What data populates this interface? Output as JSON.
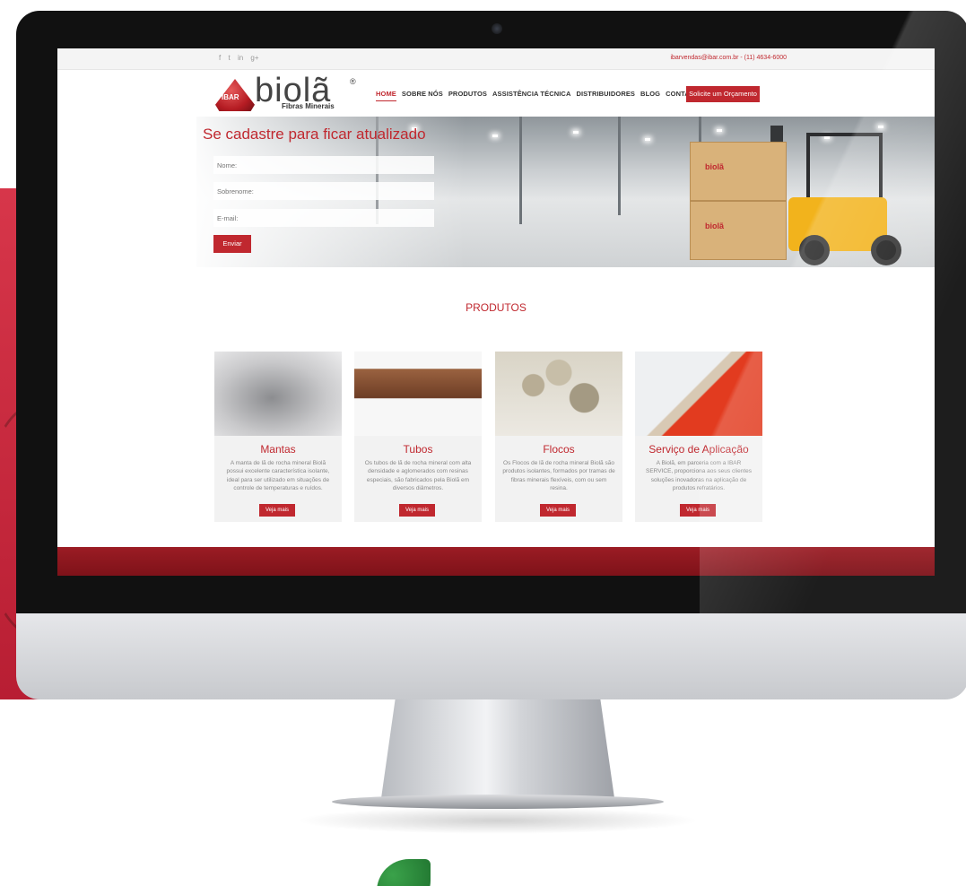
{
  "topbar": {
    "social_icons": [
      "facebook-icon",
      "twitter-icon",
      "linkedin-icon",
      "google-plus-icon"
    ],
    "social_glyphs": [
      "f",
      "t",
      "in",
      "g+"
    ],
    "contact": "ibarvendas@ibar.com.br - (11) 4634-6000"
  },
  "logo": {
    "badge_text": "IBAR",
    "wordmark": "biolã",
    "reg": "®",
    "subtitle": "Fibras Minerais"
  },
  "nav": {
    "items": [
      "HOME",
      "SOBRE NÓS",
      "PRODUTOS",
      "ASSISTÊNCIA TÉCNICA",
      "DISTRIBUIDORES",
      "BLOG",
      "CONTATO"
    ],
    "active": "HOME",
    "quote_button": "Solicite um Orçamento"
  },
  "signup": {
    "title": "Se cadastre para ficar atualizado",
    "name_placeholder": "Nome:",
    "surname_placeholder": "Sobrenome:",
    "email_placeholder": "E-mail:",
    "submit": "Enviar"
  },
  "hero": {
    "box_brand": "biolã"
  },
  "products": {
    "title": "PRODUTOS",
    "cards": [
      {
        "title": "Mantas",
        "description": "A manta de lã de rocha mineral Biolã possui excelente característica isolante, ideal para ser utilizado em situações de controle de temperaturas e ruídos.",
        "button": "Veja mais"
      },
      {
        "title": "Tubos",
        "description": "Os tubos de lã de rocha mineral com alta densidade e aglomerados com resinas especiais, são fabricados pela Biolã em diversos diâmetros.",
        "button": "Veja mais"
      },
      {
        "title": "Flocos",
        "description": "Os Flocos de lã de rocha mineral Biolã são produtos isolantes, formados por tramas de fibras minerais flexíveis, com ou sem resina.",
        "button": "Veja mais"
      },
      {
        "title": "Serviço de Aplicação",
        "description": "A Biolã, em parceria com a IBAR SERVICE, proporciona aos seus clientes soluções inovadoras na aplicação de produtos refratários.",
        "button": "Veja mais"
      }
    ]
  },
  "colors": {
    "brand_red": "#c0282f",
    "footer_red": "#8b1820"
  }
}
